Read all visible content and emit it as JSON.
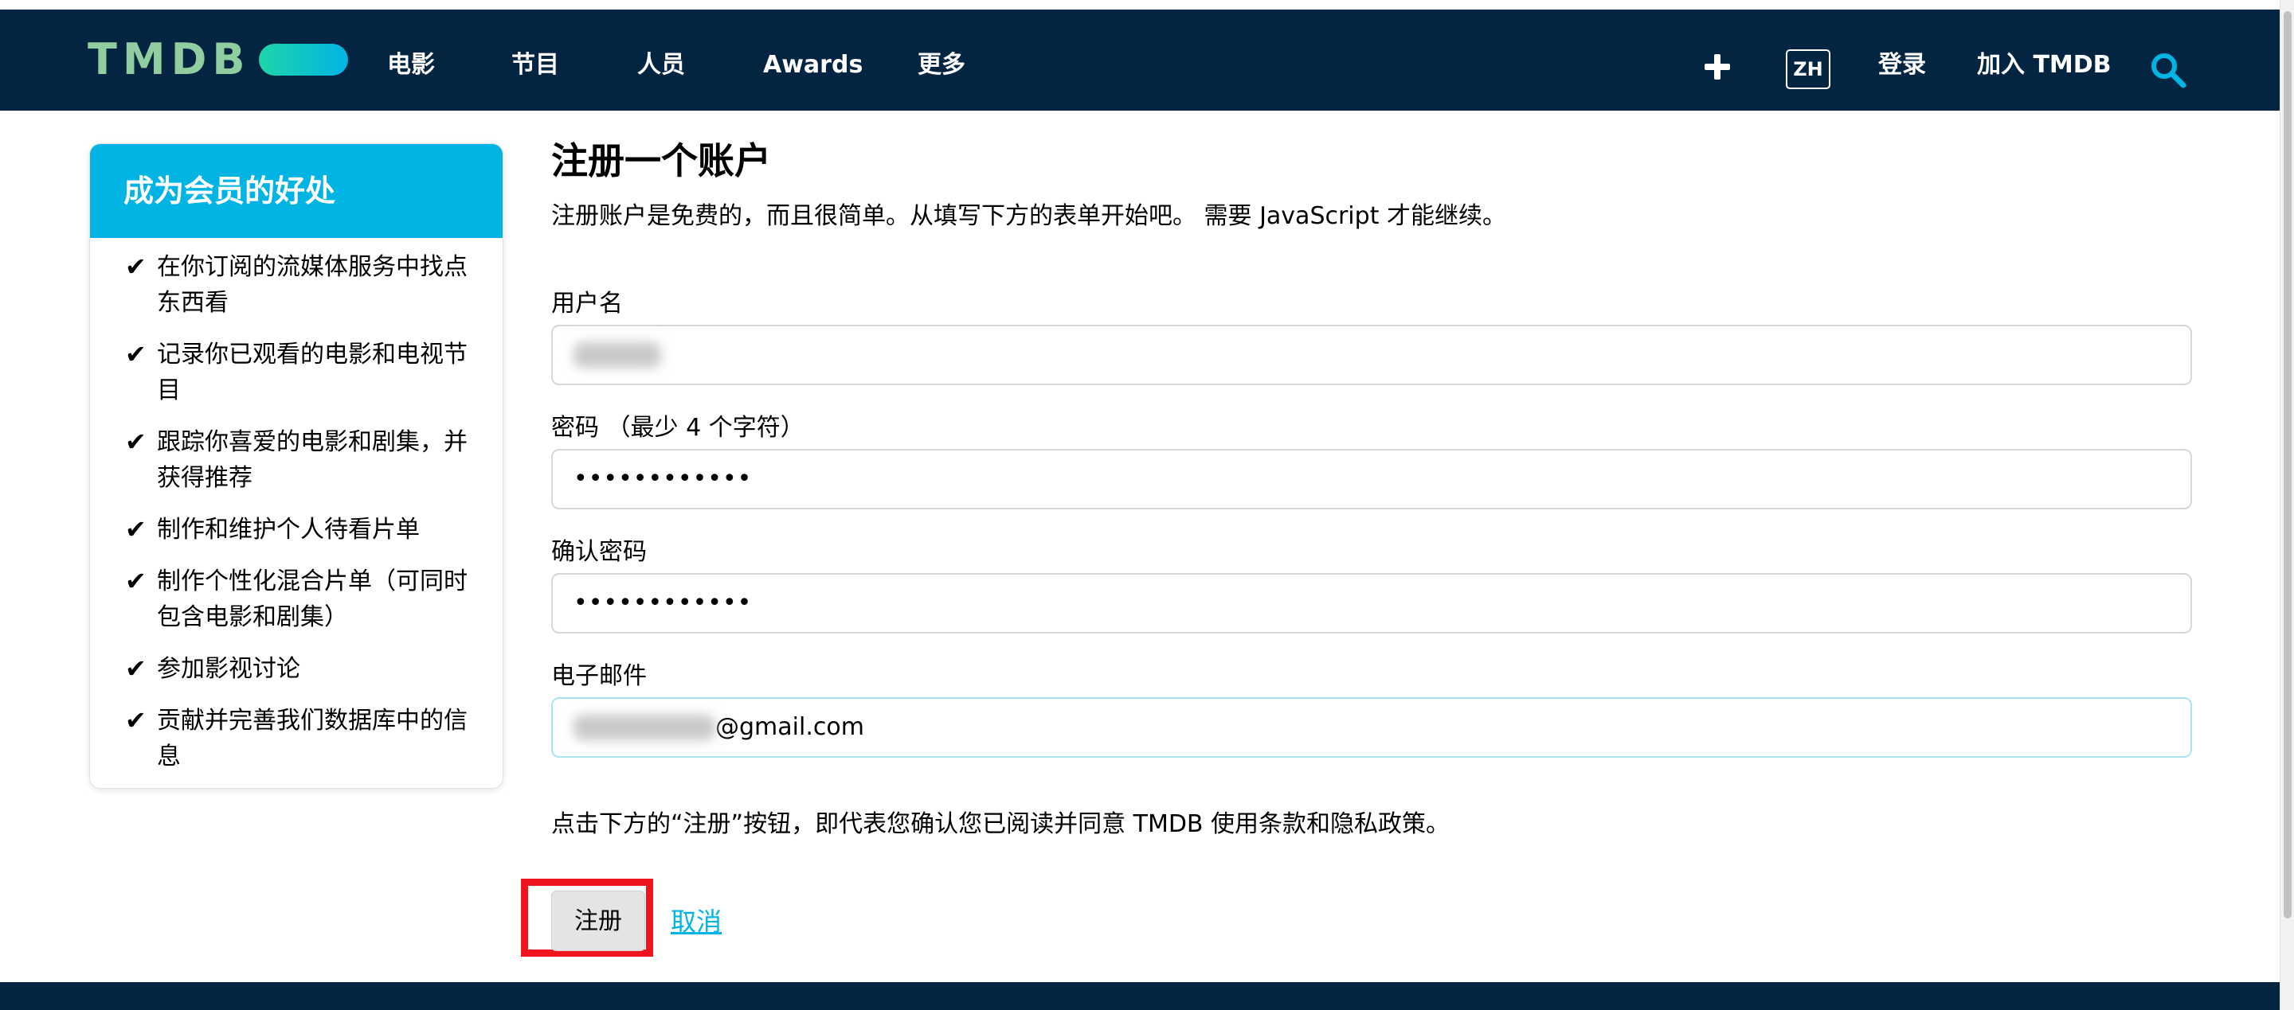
{
  "header": {
    "logo": "TMDB",
    "nav": [
      "电影",
      "节目",
      "人员",
      "Awards",
      "更多"
    ],
    "lang": "ZH",
    "login": "登录",
    "join": "加入 TMDB",
    "icons": [
      "plus-icon",
      "search-icon"
    ],
    "colors": {
      "bar": "#032541",
      "accent": "#01b4e4",
      "logo_green": "#90cea1"
    }
  },
  "sidebar": {
    "title": "成为会员的好处",
    "benefits": [
      "在你订阅的流媒体服务中找点东西看",
      "记录你已观看的电影和电视节目",
      "跟踪你喜爱的电影和剧集，并获得推荐",
      "制作和维护个人待看片单",
      "制作个性化混合片单（可同时包含电影和剧集）",
      "参加影视讨论",
      "贡献并完善我们数据库中的信息"
    ]
  },
  "form": {
    "title": "注册一个账户",
    "intro": "注册账户是免费的，而且很简单。从填写下方的表单开始吧。 需要 JavaScript 才能继续。",
    "username_label": "用户名",
    "password_label": "密码 （最少 4 个字符）",
    "password_value": "••••••••••••",
    "confirm_label": "确认密码",
    "confirm_value": "••••••••••••",
    "email_label": "电子邮件",
    "email_suffix": "@gmail.com",
    "terms": "点击下方的“注册”按钮，即代表您确认您已阅读并同意 TMDB 使用条款和隐私政策。",
    "register": "注册",
    "cancel": "取消"
  }
}
